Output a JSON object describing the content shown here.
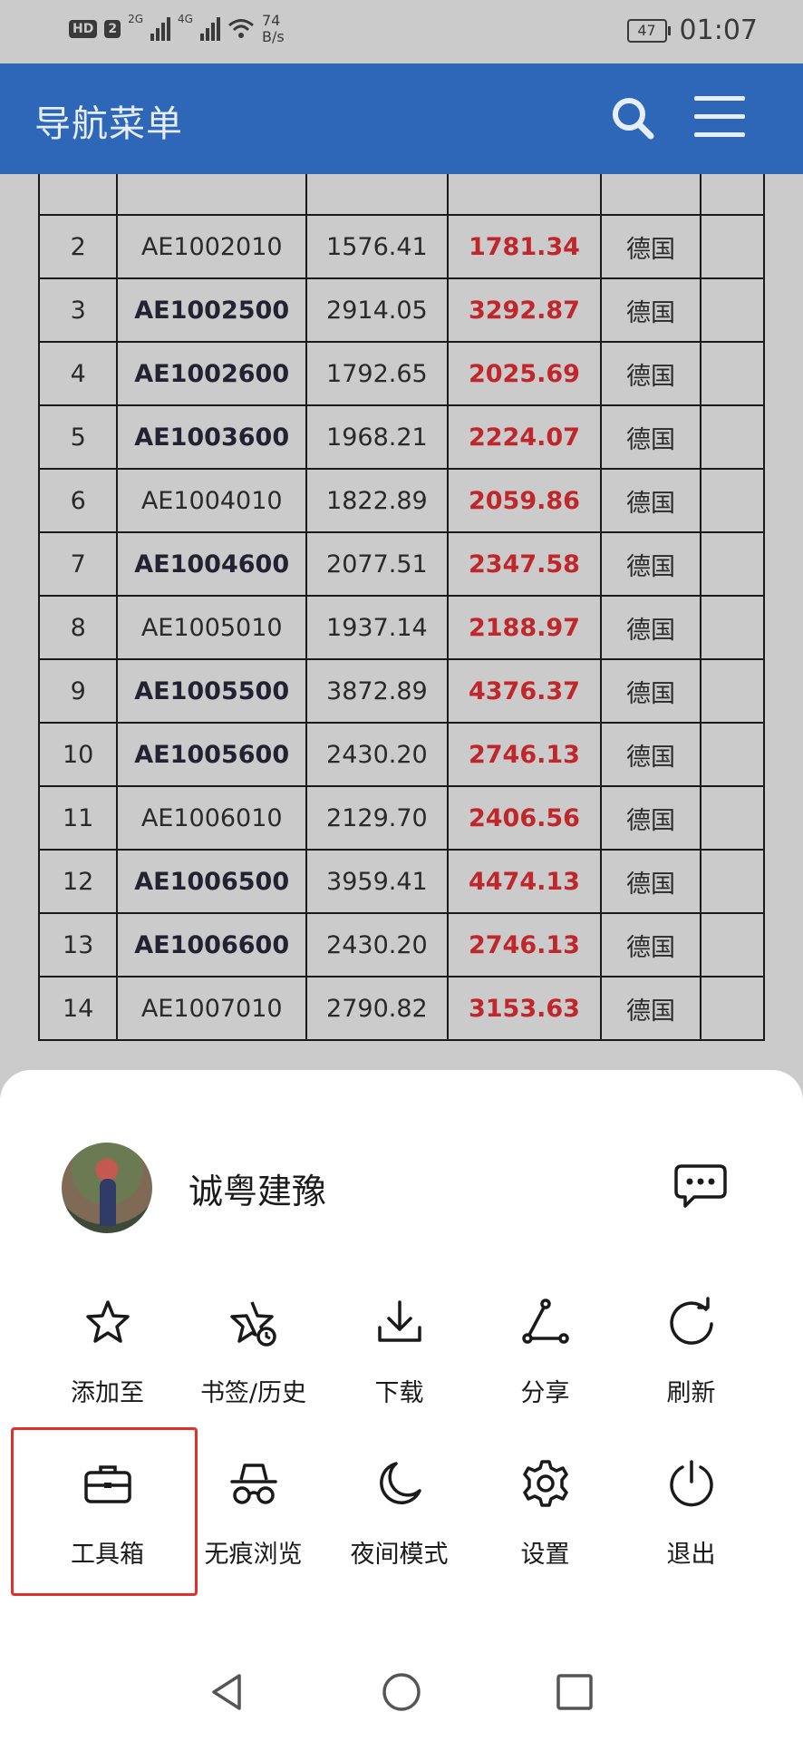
{
  "status_bar": {
    "hd_badge": "HD",
    "sim_slot": "2",
    "net1": "2G",
    "net2": "4G",
    "speed_value": "74",
    "speed_unit": "B/s",
    "battery": "47",
    "time": "01:07"
  },
  "header": {
    "title": "导航菜单",
    "search_icon": "search-icon",
    "menu_icon": "hamburger-icon"
  },
  "table": {
    "rows": [
      {
        "no": "2",
        "code": "AE1002010",
        "price": "1576.41",
        "price2": "1781.34",
        "origin": "德国",
        "bold": false
      },
      {
        "no": "3",
        "code": "AE1002500",
        "price": "2914.05",
        "price2": "3292.87",
        "origin": "德国",
        "bold": true
      },
      {
        "no": "4",
        "code": "AE1002600",
        "price": "1792.65",
        "price2": "2025.69",
        "origin": "德国",
        "bold": true
      },
      {
        "no": "5",
        "code": "AE1003600",
        "price": "1968.21",
        "price2": "2224.07",
        "origin": "德国",
        "bold": true
      },
      {
        "no": "6",
        "code": "AE1004010",
        "price": "1822.89",
        "price2": "2059.86",
        "origin": "德国",
        "bold": false
      },
      {
        "no": "7",
        "code": "AE1004600",
        "price": "2077.51",
        "price2": "2347.58",
        "origin": "德国",
        "bold": true
      },
      {
        "no": "8",
        "code": "AE1005010",
        "price": "1937.14",
        "price2": "2188.97",
        "origin": "德国",
        "bold": false
      },
      {
        "no": "9",
        "code": "AE1005500",
        "price": "3872.89",
        "price2": "4376.37",
        "origin": "德国",
        "bold": true
      },
      {
        "no": "10",
        "code": "AE1005600",
        "price": "2430.20",
        "price2": "2746.13",
        "origin": "德国",
        "bold": true
      },
      {
        "no": "11",
        "code": "AE1006010",
        "price": "2129.70",
        "price2": "2406.56",
        "origin": "德国",
        "bold": false
      },
      {
        "no": "12",
        "code": "AE1006500",
        "price": "3959.41",
        "price2": "4474.13",
        "origin": "德国",
        "bold": true
      },
      {
        "no": "13",
        "code": "AE1006600",
        "price": "2430.20",
        "price2": "2746.13",
        "origin": "德国",
        "bold": true
      },
      {
        "no": "14",
        "code": "AE1007010",
        "price": "2790.82",
        "price2": "3153.63",
        "origin": "德国",
        "bold": false
      }
    ]
  },
  "sheet": {
    "user_name": "诚粤建豫",
    "chat_icon": "chat-bubble-icon",
    "row1": [
      {
        "label": "添加至",
        "icon": "star-icon"
      },
      {
        "label": "书签/历史",
        "icon": "star-clock-icon"
      },
      {
        "label": "下载",
        "icon": "download-icon"
      },
      {
        "label": "分享",
        "icon": "share-icon"
      },
      {
        "label": "刷新",
        "icon": "refresh-icon"
      }
    ],
    "row2": [
      {
        "label": "工具箱",
        "icon": "toolbox-icon"
      },
      {
        "label": "无痕浏览",
        "icon": "incognito-icon"
      },
      {
        "label": "夜间模式",
        "icon": "moon-icon"
      },
      {
        "label": "设置",
        "icon": "gear-icon"
      },
      {
        "label": "退出",
        "icon": "power-icon"
      }
    ],
    "highlight_color": "#e0302a"
  },
  "colors": {
    "header_bg": "#2f67b8",
    "price_red": "#c0262a"
  }
}
